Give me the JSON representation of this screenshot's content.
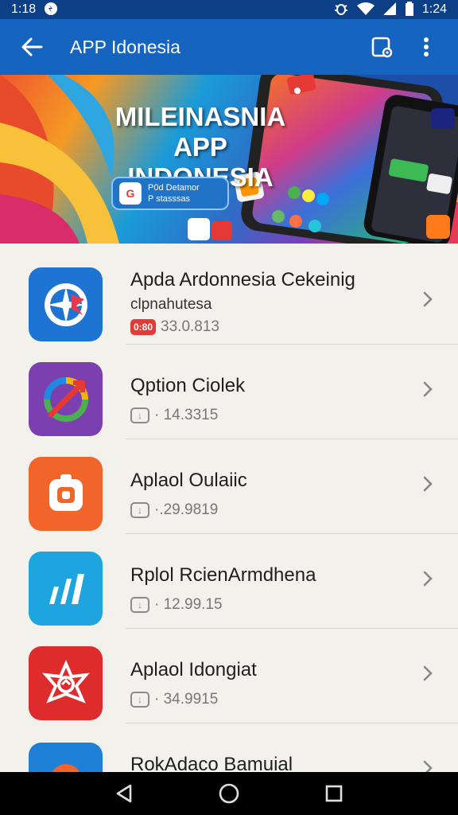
{
  "status_bar": {
    "time_left": "1:18",
    "time_right": "1:24"
  },
  "app_bar": {
    "title": "APP Idonesia"
  },
  "banner": {
    "title_line1": "MILEINASNIA",
    "title_line2": "APP INDONESIA",
    "badge_line1": "P0d Detamor",
    "badge_line2": "P stasssas"
  },
  "apps": [
    {
      "name": "Apda Ardonnesia Cekeinig",
      "subtitle": "clpnahutesa",
      "meta": "33.0.813",
      "tag": "0:80",
      "tag_style": "red",
      "icon_color": "#1e74d2",
      "icon": "compass-bird-icon"
    },
    {
      "name": "Qption Ciolek",
      "subtitle": "",
      "meta": "· 14.3315",
      "tag": "",
      "tag_style": "outline",
      "icon_color": "#7b3fb0",
      "icon": "swirl-arrow-icon"
    },
    {
      "name": "Aplaol Oulaiic",
      "subtitle": "",
      "meta": "·.29.9819",
      "tag": "",
      "tag_style": "outline",
      "icon_color": "#f1652a",
      "icon": "camera-frame-icon"
    },
    {
      "name": "Rplol RcienArmdhena",
      "subtitle": "",
      "meta": "· 12.99.15",
      "tag": "",
      "tag_style": "outline",
      "icon_color": "#1ea4de",
      "icon": "bars-icon"
    },
    {
      "name": "Aplaol Idongiat",
      "subtitle": "",
      "meta": "· 34.9915",
      "tag": "",
      "tag_style": "outline",
      "icon_color": "#de2c2c",
      "icon": "star-burst-icon"
    },
    {
      "name": "RokAdaco Bamuial",
      "subtitle": "",
      "meta": "",
      "tag": "",
      "tag_style": "outline",
      "icon_color": "#1e7fd6",
      "icon": "app-icon"
    }
  ]
}
